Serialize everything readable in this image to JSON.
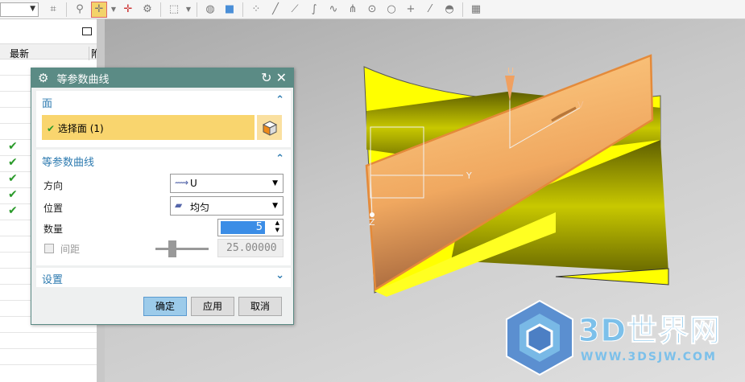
{
  "toolbar": {
    "icons": [
      "dropdown",
      "snap-icon",
      "filter-icon",
      "selection-filter-icon",
      "point-snap-icon",
      "component-icon",
      "rectangle-select-icon",
      "shaded-view-icon",
      "cube-icon",
      "scatter-icon",
      "line-icon",
      "line2-icon",
      "curve-icon",
      "spline-icon",
      "intersection-icon",
      "circle-point-icon",
      "circle-icon",
      "cross-icon",
      "tangent-icon",
      "face-icon",
      "grid-icon"
    ]
  },
  "left_panel": {
    "column_latest": "最新",
    "column_partial": "附"
  },
  "dialog": {
    "title": "等参数曲线",
    "section_face": {
      "title": "面",
      "select_label": "选择面 (1)"
    },
    "section_curve": {
      "title": "等参数曲线",
      "direction_label": "方向",
      "direction_value": "U",
      "position_label": "位置",
      "position_value": "均匀",
      "count_label": "数量",
      "count_value": "5",
      "spacing_label": "间距",
      "spacing_value": "25.00000"
    },
    "section_settings": {
      "title": "设置"
    },
    "ok": "确定",
    "apply": "应用",
    "cancel": "取消"
  },
  "viewport": {
    "axis_u": "U",
    "axis_v": "V",
    "axis_y": "Y",
    "axis_z": "Z"
  },
  "watermark": {
    "title": "3D世界网",
    "url": "WWW.3DSJW.COM"
  }
}
